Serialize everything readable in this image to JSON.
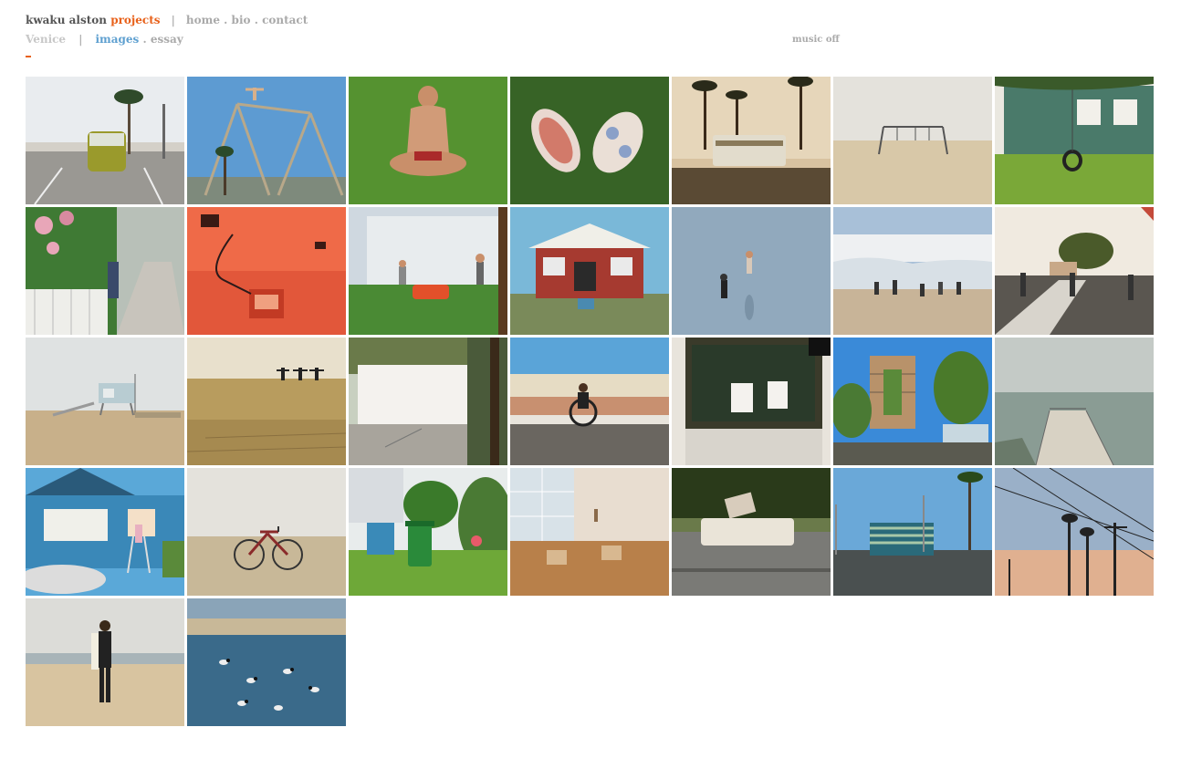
{
  "header": {
    "name": "kwaku alston",
    "projects": "projects",
    "separator": "|",
    "home": "home",
    "bio": "bio",
    "contact": "contact",
    "dot": "."
  },
  "subnav": {
    "place": "Venice",
    "separator": "|",
    "images": "images",
    "essay": "essay",
    "dot": "."
  },
  "music": "music off",
  "accent_color": "#e8611a",
  "link_color": "#5fa0d0",
  "thumbnails": [
    {
      "subject": "van-palm-beach-lot"
    },
    {
      "subject": "swing-frame-gymnast"
    },
    {
      "subject": "man-sitting-grass"
    },
    {
      "subject": "skateboards-grass"
    },
    {
      "subject": "rv-palms-sunset"
    },
    {
      "subject": "swings-foggy-beach"
    },
    {
      "subject": "green-house-tire-swing"
    },
    {
      "subject": "flower-fence-sidewalk"
    },
    {
      "subject": "red-room-machine"
    },
    {
      "subject": "wall-lawnmower-men"
    },
    {
      "subject": "red-bungalow"
    },
    {
      "subject": "beach-photographer-model"
    },
    {
      "subject": "wave-runners"
    },
    {
      "subject": "street-crossing-skaters"
    },
    {
      "subject": "lifeguard-tower"
    },
    {
      "subject": "three-figures-dune"
    },
    {
      "subject": "white-wall-corner"
    },
    {
      "subject": "wheelchair-boardwalk"
    },
    {
      "subject": "shop-window-posters"
    },
    {
      "subject": "building-scaffold-tree"
    },
    {
      "subject": "pier-fog"
    },
    {
      "subject": "blue-house-ladder"
    },
    {
      "subject": "bicycle-beach"
    },
    {
      "subject": "green-trash-bin-garden"
    },
    {
      "subject": "sunlit-room-chairs"
    },
    {
      "subject": "mattress-curb"
    },
    {
      "subject": "striped-building-palms"
    },
    {
      "subject": "power-lines-palms-dusk"
    },
    {
      "subject": "surfer-wetsuit"
    },
    {
      "subject": "surfers-in-water"
    }
  ]
}
